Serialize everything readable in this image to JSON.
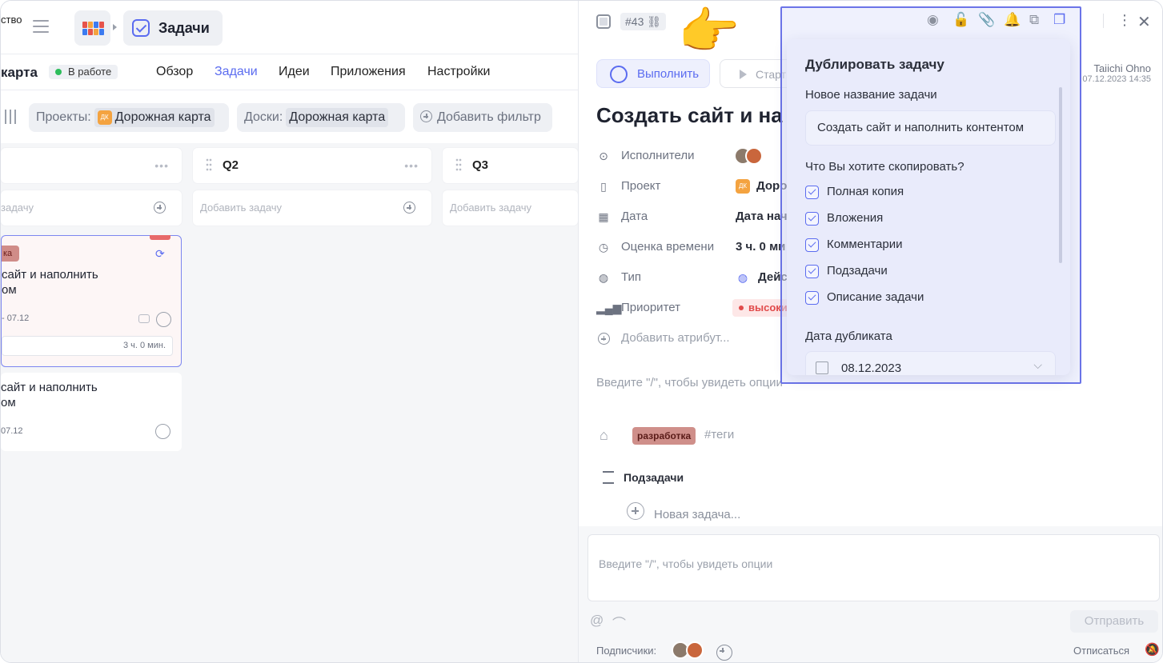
{
  "app": {
    "workspace_fragment": "ство",
    "breadcrumb_section": "Задачи"
  },
  "project_bar": {
    "name": "карта",
    "status": "В работе",
    "tabs": [
      {
        "label": "Обзор",
        "active": false
      },
      {
        "label": "Задачи",
        "active": true
      },
      {
        "label": "Идеи",
        "active": false
      },
      {
        "label": "Приложения",
        "active": false
      },
      {
        "label": "Настройки",
        "active": false
      }
    ]
  },
  "filters": {
    "projects_label": "Проекты:",
    "projects_badge": "ДК",
    "projects_value": "Дорожная карта",
    "boards_label": "Доски:",
    "boards_value": "Дорожная карта",
    "add_filter": "Добавить фильтр"
  },
  "kanban": {
    "columns": [
      {
        "title": "",
        "add_placeholder": "задачу"
      },
      {
        "title": "Q2",
        "add_placeholder": "Добавить задачу"
      },
      {
        "title": "Q3",
        "add_placeholder": "Добавить задачу"
      }
    ],
    "cards": [
      {
        "tag": "ка",
        "title_line1": "сайт и наполнить",
        "title_line2": "ом",
        "date": "-  07.12",
        "time": "3 ч. 0 мин."
      },
      {
        "title_line1": "сайт и наполнить",
        "title_line2": "ом",
        "date": "07.12"
      }
    ]
  },
  "task": {
    "number": "#43",
    "complete_label": "Выполнить",
    "start_label": "Старт",
    "author": "Taiichi Ohno",
    "created": "07.12.2023 14:35",
    "title": "Создать сайт и на",
    "attributes": [
      {
        "key": "Исполнители",
        "value": ""
      },
      {
        "key": "Проект",
        "value": "Доро"
      },
      {
        "key": "Дата",
        "value": "Дата нача"
      },
      {
        "key": "Оценка времени",
        "value": "3 ч. 0 ми"
      },
      {
        "key": "Тип",
        "value": "Дейс"
      },
      {
        "key": "Приоритет",
        "value": "высоки"
      }
    ],
    "project_badge": "ДК",
    "add_attribute": "Добавить атрибут...",
    "description_placeholder": "Введите \"/\", чтобы увидеть опции",
    "tag": "разработка",
    "tags_placeholder": "#теги",
    "subtasks_title": "Подзадачи",
    "new_subtask": "Новая задача..."
  },
  "comments": {
    "placeholder": "Введите \"/\", чтобы увидеть опции",
    "send_label": "Отправить",
    "subscribers_label": "Подписчики:",
    "unsubscribe_label": "Отписаться"
  },
  "duplicate_popup": {
    "title": "Дублировать задачу",
    "name_label": "Новое название задачи",
    "name_value": "Создать сайт и наполнить контентом",
    "copy_question": "Что Вы хотите скопировать?",
    "options": [
      {
        "label": "Полная копия",
        "checked": true
      },
      {
        "label": "Вложения",
        "checked": true
      },
      {
        "label": "Комментарии",
        "checked": true
      },
      {
        "label": "Подзадачи",
        "checked": true
      },
      {
        "label": "Описание задачи",
        "checked": true
      }
    ],
    "date_label": "Дата дубликата",
    "date_value": "08.12.2023"
  },
  "colors": {
    "accent": "#5b6cf0",
    "priority_high": "#e14b4b",
    "status_in_progress": "#2dbd5b",
    "project_badge": "#f4a340",
    "tag_dev": "#cf8f8a",
    "highlight_frame": "#6b74e8"
  },
  "icons": {
    "pointer": "pointing-hand-emoji",
    "toolbar": [
      "eye-icon",
      "lock-icon",
      "paperclip-icon",
      "bell-icon",
      "hierarchy-icon",
      "duplicate-icon"
    ]
  }
}
